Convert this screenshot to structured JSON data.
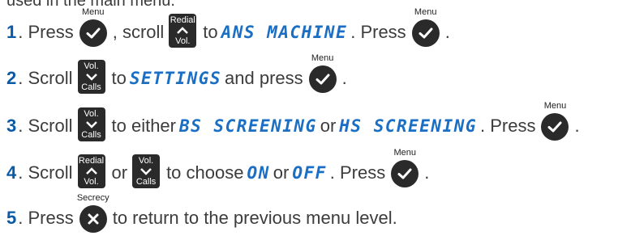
{
  "header_partial": "used in the main menu.",
  "labels": {
    "menu": "Menu",
    "redial": "Redial",
    "vol": "Vol.",
    "calls": "Calls",
    "secrecy": "Secrecy"
  },
  "steps": [
    {
      "num": "1",
      "t1": ". Press ",
      "t2": ", scroll ",
      "t3": " to ",
      "lcd": "ANS MACHINE",
      "t4": ". Press ",
      "t5": "."
    },
    {
      "num": "2",
      "t1": ". Scroll ",
      "t2": " to ",
      "lcd": "SETTINGS",
      "t3": " and press ",
      "t4": "."
    },
    {
      "num": "3",
      "t1": ". Scroll ",
      "t2": " to either ",
      "lcd1": "BS SCREENING",
      "t3": " or ",
      "lcd2": "HS SCREENING",
      "t4": ". Press ",
      "t5": "."
    },
    {
      "num": "4",
      "t1": ". Scroll ",
      "t2": " or ",
      "t3": " to choose ",
      "lcd1": "ON",
      "t4": " or ",
      "lcd2": "OFF",
      "t5": ". Press ",
      "t6": "."
    },
    {
      "num": "5",
      "t1": ". Press ",
      "t2": " to return to the previous menu level."
    }
  ]
}
